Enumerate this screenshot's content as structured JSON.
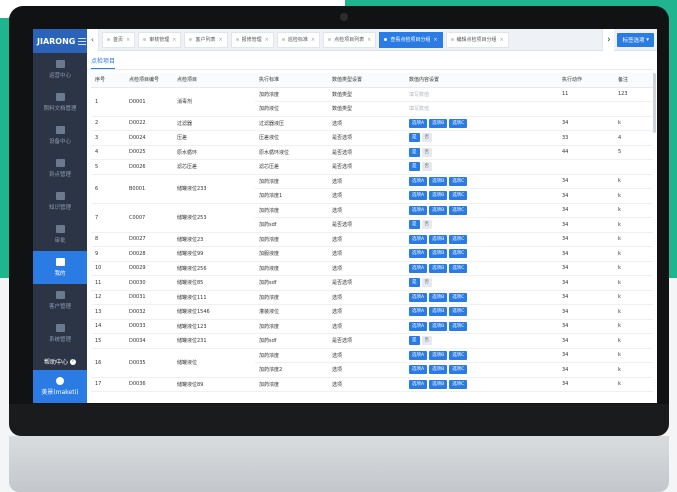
{
  "brand": "JIARONG",
  "sidebar": {
    "items": [
      {
        "label": "运营中心"
      },
      {
        "label": "照料文档管理"
      },
      {
        "label": "设备中心"
      },
      {
        "label": "到点管理"
      },
      {
        "label": "知识管理"
      },
      {
        "label": "审批"
      },
      {
        "label": "我的",
        "active": true
      },
      {
        "label": "客户管理"
      },
      {
        "label": "系统管理"
      }
    ],
    "help": "帮助中心",
    "user": "美景(maketi)"
  },
  "tabs": [
    {
      "label": "首页"
    },
    {
      "label": "审核管理"
    },
    {
      "label": "客户列表"
    },
    {
      "label": "报修管理"
    },
    {
      "label": "巡检标准"
    },
    {
      "label": "点检项目列表"
    },
    {
      "label": "查看点检项目分组",
      "active": true
    },
    {
      "label": "编辑点检项目分组"
    }
  ],
  "tab_options": "标签选项",
  "subtab": "点检项目",
  "table": {
    "headers": [
      "序号",
      "点检项目编号",
      "点检项目",
      "执行标准",
      "数值类型设置",
      "数值内容设置",
      "执行动作",
      "备注"
    ],
    "groups": [
      {
        "no": "1",
        "code": "D0001",
        "name": "消毒剂",
        "rows": [
          {
            "std": "加药浓度",
            "type": "数值类型",
            "content": {
              "kind": "placeholder",
              "text": "填写数值"
            },
            "action": "11",
            "note": "123"
          },
          {
            "std": "加药液位",
            "type": "数值类型",
            "content": {
              "kind": "placeholder",
              "text": "填写数值"
            },
            "action": "",
            "note": ""
          }
        ]
      },
      {
        "no": "2",
        "code": "D0022",
        "name": "过滤器",
        "rows": [
          {
            "std": "过滤器液压",
            "type": "选项",
            "content": {
              "kind": "abc"
            },
            "action": "34",
            "note": "k"
          }
        ]
      },
      {
        "no": "3",
        "code": "D0024",
        "name": "压差",
        "rows": [
          {
            "std": "压差液位",
            "type": "是否选项",
            "content": {
              "kind": "yesno"
            },
            "action": "33",
            "note": "4"
          }
        ]
      },
      {
        "no": "4",
        "code": "D0025",
        "name": "原水循环",
        "rows": [
          {
            "std": "原水循环液位",
            "type": "是否选项",
            "content": {
              "kind": "yesno"
            },
            "action": "44",
            "note": "5"
          }
        ]
      },
      {
        "no": "5",
        "code": "D0026",
        "name": "滤芯压差",
        "rows": [
          {
            "std": "滤芯压差",
            "type": "是否选项",
            "content": {
              "kind": "yesno"
            },
            "action": "",
            "note": ""
          }
        ]
      },
      {
        "no": "6",
        "code": "B0001",
        "name": "储罐液位233",
        "rows": [
          {
            "std": "加药浓度",
            "type": "选项",
            "content": {
              "kind": "abc"
            },
            "action": "34",
            "note": "k"
          },
          {
            "std": "加药浓度1",
            "type": "选项",
            "content": {
              "kind": "abc"
            },
            "action": "34",
            "note": "k"
          }
        ]
      },
      {
        "no": "7",
        "code": "C0007",
        "name": "储罐液位253",
        "rows": [
          {
            "std": "加药浓度",
            "type": "选项",
            "content": {
              "kind": "abc"
            },
            "action": "34",
            "note": "k"
          },
          {
            "std": "加药sdf",
            "type": "是否选项",
            "content": {
              "kind": "yesno"
            },
            "action": "34",
            "note": "k"
          }
        ]
      },
      {
        "no": "8",
        "code": "D0027",
        "name": "储罐液位23",
        "rows": [
          {
            "std": "加药浓度",
            "type": "选项",
            "content": {
              "kind": "abc"
            },
            "action": "34",
            "note": "k"
          }
        ]
      },
      {
        "no": "9",
        "code": "D0028",
        "name": "储罐液位99",
        "rows": [
          {
            "std": "加服液度",
            "type": "选项",
            "content": {
              "kind": "abc"
            },
            "action": "34",
            "note": "k"
          }
        ]
      },
      {
        "no": "10",
        "code": "D0029",
        "name": "储罐液位256",
        "rows": [
          {
            "std": "加药液度",
            "type": "选项",
            "content": {
              "kind": "abc"
            },
            "action": "34",
            "note": "k"
          }
        ]
      },
      {
        "no": "11",
        "code": "D0030",
        "name": "储罐液位85",
        "rows": [
          {
            "std": "加药sdf",
            "type": "是否选项",
            "content": {
              "kind": "yesno"
            },
            "action": "34",
            "note": "k"
          }
        ]
      },
      {
        "no": "12",
        "code": "D0031",
        "name": "储罐液位111",
        "rows": [
          {
            "std": "加药浓度",
            "type": "选项",
            "content": {
              "kind": "abc"
            },
            "action": "34",
            "note": "k"
          }
        ]
      },
      {
        "no": "13",
        "code": "D0032",
        "name": "储罐液位1546",
        "rows": [
          {
            "std": "灌装液位",
            "type": "选项",
            "content": {
              "kind": "abc"
            },
            "action": "34",
            "note": "k"
          }
        ]
      },
      {
        "no": "14",
        "code": "D0033",
        "name": "储罐液位123",
        "rows": [
          {
            "std": "加药浓度",
            "type": "选项",
            "content": {
              "kind": "abc"
            },
            "action": "34",
            "note": "k"
          }
        ]
      },
      {
        "no": "15",
        "code": "D0034",
        "name": "储罐液位231",
        "rows": [
          {
            "std": "加药sdf",
            "type": "是否选项",
            "content": {
              "kind": "yesno"
            },
            "action": "34",
            "note": "k"
          }
        ]
      },
      {
        "no": "16",
        "code": "D0035",
        "name": "储罐液位",
        "rows": [
          {
            "std": "加药浓度",
            "type": "选项",
            "content": {
              "kind": "abc"
            },
            "action": "34",
            "note": "k"
          },
          {
            "std": "加药浓度2",
            "type": "选项",
            "content": {
              "kind": "abc"
            },
            "action": "34",
            "note": "k"
          }
        ]
      },
      {
        "no": "17",
        "code": "D0036",
        "name": "储罐液位89",
        "rows": [
          {
            "std": "加药浓度",
            "type": "选项",
            "content": {
              "kind": "abc"
            },
            "action": "34",
            "note": "k"
          }
        ]
      }
    ]
  },
  "option_labels": {
    "a": "选项A",
    "b": "选项B",
    "c": "选项C",
    "yes": "是",
    "no": "否"
  }
}
